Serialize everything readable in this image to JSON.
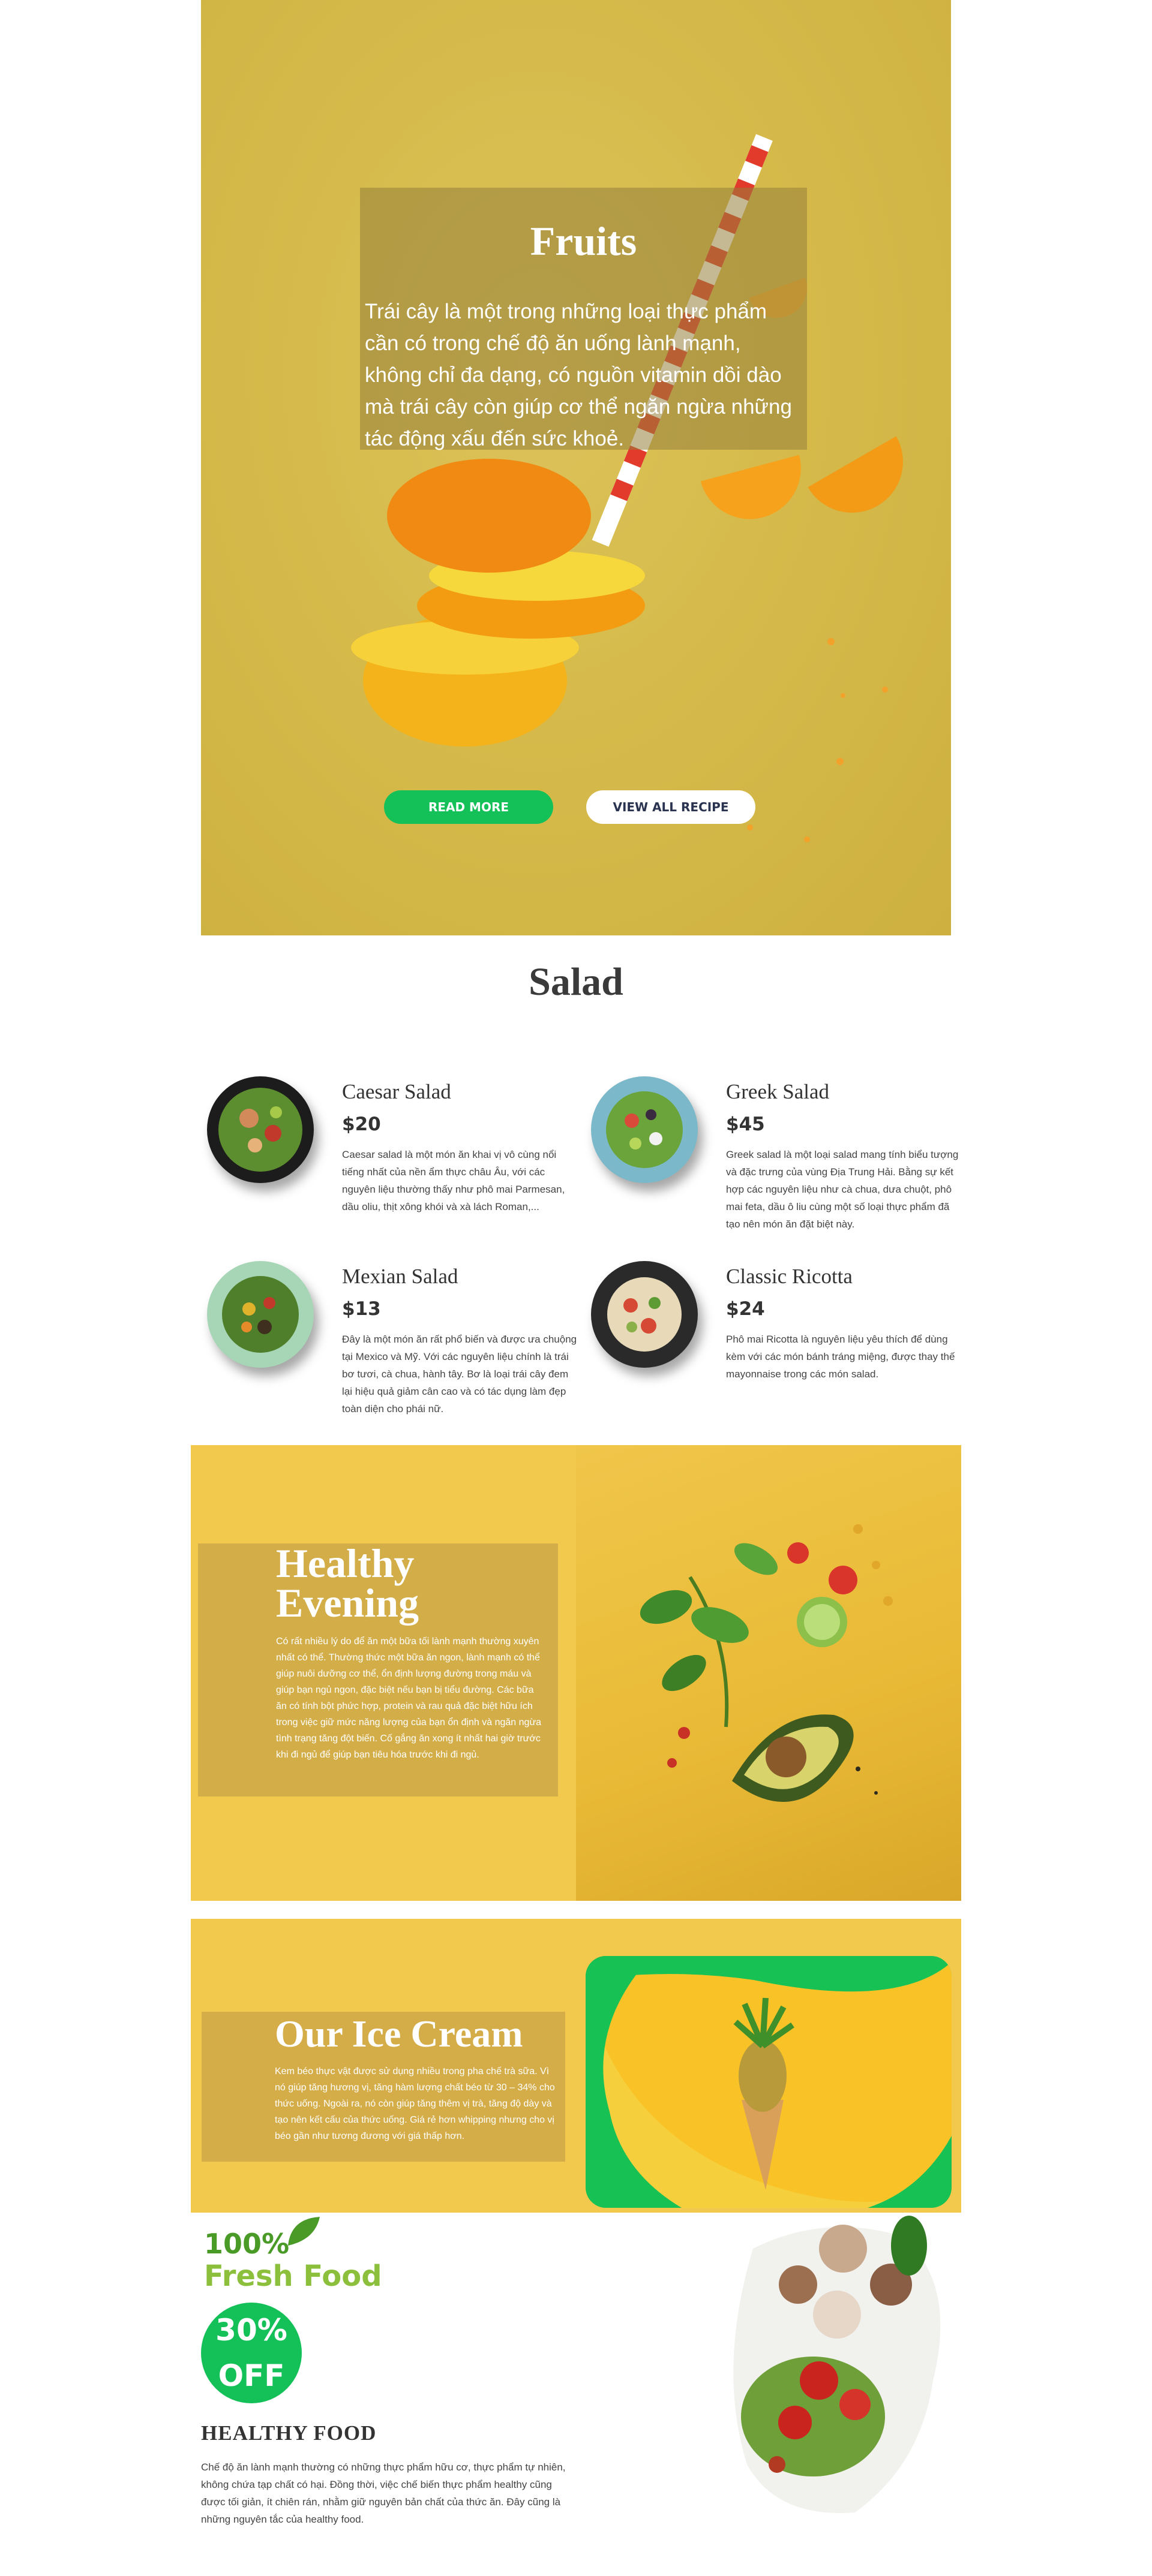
{
  "hero": {
    "title": "Fruits",
    "text": "Trái cây là một trong những loại thực phẩm cần có trong chế độ ăn uống lành mạnh, không chỉ đa dạng, có nguồn vitamin dồi dào mà trái cây còn giúp cơ thể ngăn ngừa những tác động xấu đến sức khoẻ.",
    "read_more": "READ MORE",
    "view_all": "VIEW ALL RECIPE"
  },
  "salad": {
    "heading": "Salad",
    "items": [
      {
        "name": "Caesar Salad",
        "price": "$20",
        "desc": "Caesar salad là một món ăn khai vị vô cùng nổi tiếng nhất của nền ẩm thực châu Âu, với các nguyên liệu thường thấy như phô mai Parmesan, dầu oliu, thịt xông khói và xà lách Roman,..."
      },
      {
        "name": "Greek Salad",
        "price": "$45",
        "desc": "Greek salad là một loại salad mang tính biểu tượng và đặc trưng của vùng Địa Trung Hải. Bằng sự kết hợp các nguyên liệu như cà chua, dưa chuột, phô mai feta, dầu ô liu cùng một số loại thực phẩm đã tạo nên món ăn đặt biệt này."
      },
      {
        "name": "Mexian Salad",
        "price": "$13",
        "desc": "Đây là một món ăn rất phổ biến và được ưa chuộng tại Mexico và Mỹ. Với các nguyên liệu chính là trái bơ tươi, cà chua, hành tây. Bơ là loại trái cây đem lại hiệu quả giảm cân cao và có tác dụng làm đẹp toàn diện cho phái nữ."
      },
      {
        "name": "Classic Ricotta",
        "price": "$24",
        "desc": "Phô mai Ricotta là nguyên liệu yêu thích để dùng kèm với các món bánh tráng miệng, được thay thế mayonnaise trong các món salad."
      }
    ]
  },
  "evening": {
    "title": "Healthy Evening",
    "text": "Có rất nhiều lý do để ăn một bữa tối lành mạnh thường xuyên nhất có thể. Thường thức một bữa ăn ngon, lành mạnh có thể giúp nuôi dưỡng cơ thể, ổn định lượng đường trong máu và giúp bạn ngủ ngon, đặc biệt nếu bạn bị tiểu đường. Các bữa ăn có tính bột phức hợp, protein và rau quả đặc biệt hữu ích trong việc giữ mức năng lượng của bạn ổn định và ngăn ngừa tình trạng tăng đột biến. Cố gắng ăn xong ít nhất hai giờ trước khi đi ngủ để giúp bạn tiêu hóa trước khi đi ngủ."
  },
  "icecream": {
    "title": "Our Ice Cream",
    "text": "Kem béo thực vật được sử dụng nhiều trong pha chế trà sữa. Vì nó giúp tăng hương vị, tăng hàm lượng chất béo từ 30 – 34% cho thức uống. Ngoài ra, nó còn giúp tăng thêm vị trà, tăng độ dày và tạo nên kết cấu của thức uống. Giá rẻ hơn whipping nhưng cho vị béo gần như tương đương với giá thấp hơn."
  },
  "fresh": {
    "percent": "100%",
    "label": "Fresh Food",
    "discount": "30%",
    "off": "OFF",
    "title": "HEALTHY FOOD",
    "text": "Chế độ ăn lành mạnh thường có những thực phẩm hữu cơ, thực phẩm tự nhiên, không chứa tạp chất có hại. Đồng thời, việc chế biến thực phẩm healthy cũng được tối giản, ít chiên rán, nhằm giữ nguyên bản chất của thức ăn. Đây cũng là những nguyên tắc của healthy food."
  },
  "colors": {
    "accent": "#14c159",
    "hero_bg": "#d6bb4c",
    "section_bg": "#f2c94c"
  }
}
